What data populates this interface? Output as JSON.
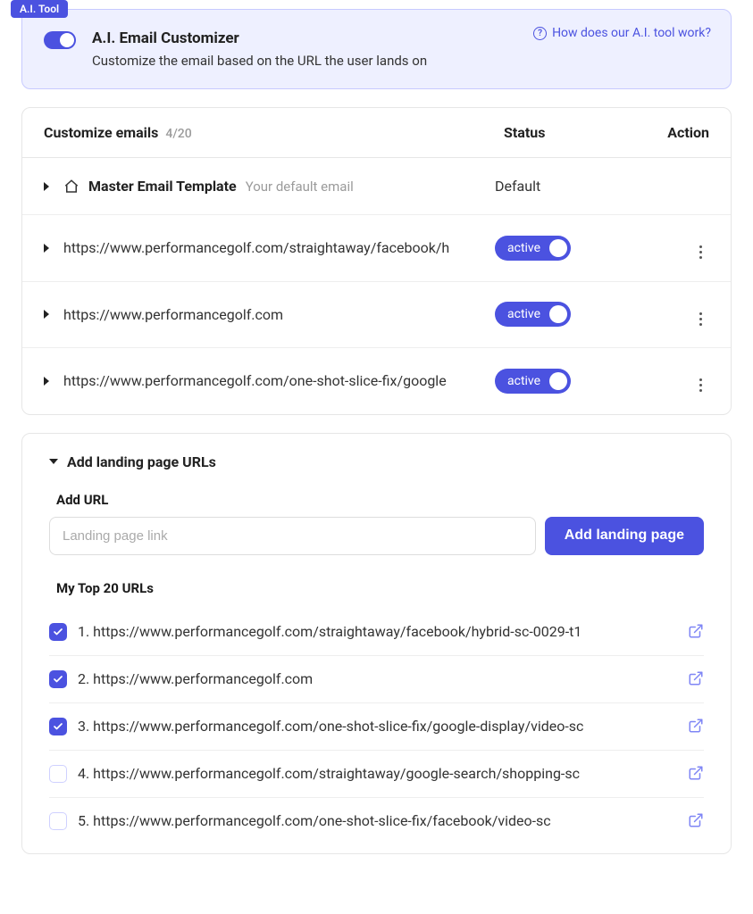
{
  "ai_tool": {
    "badge": "A.I. Tool",
    "title": "A.I. Email Customizer",
    "description": "Customize the email based on the URL the user lands on",
    "help_text": "How does our A.I. tool work?"
  },
  "emails_table": {
    "heading": "Customize emails",
    "count": "4/20",
    "col_status": "Status",
    "col_action": "Action",
    "rows": [
      {
        "label": "Master Email Template",
        "subtext": "Your default email",
        "status_text": "Default",
        "is_master": true,
        "has_toggle": false,
        "has_menu": false
      },
      {
        "label": "https://www.performancegolf.com/straightaway/facebook/h",
        "status_text": "active",
        "has_toggle": true,
        "has_menu": true
      },
      {
        "label": "https://www.performancegolf.com",
        "status_text": "active",
        "has_toggle": true,
        "has_menu": true
      },
      {
        "label": "https://www.performancegolf.com/one-shot-slice-fix/google",
        "status_text": "active",
        "has_toggle": true,
        "has_menu": true
      }
    ]
  },
  "landing": {
    "section_title": "Add landing page URLs",
    "add_url_label": "Add URL",
    "placeholder": "Landing page link",
    "button": "Add landing page",
    "top_heading": "My Top 20 URLs",
    "items": [
      {
        "label": "1. https://www.performancegolf.com/straightaway/facebook/hybrid-sc-0029-t1",
        "checked": true
      },
      {
        "label": "2. https://www.performancegolf.com",
        "checked": true
      },
      {
        "label": "3. https://www.performancegolf.com/one-shot-slice-fix/google-display/video-sc",
        "checked": true
      },
      {
        "label": "4. https://www.performancegolf.com/straightaway/google-search/shopping-sc",
        "checked": false
      },
      {
        "label": "5. https://www.performancegolf.com/one-shot-slice-fix/facebook/video-sc",
        "checked": false
      }
    ]
  }
}
